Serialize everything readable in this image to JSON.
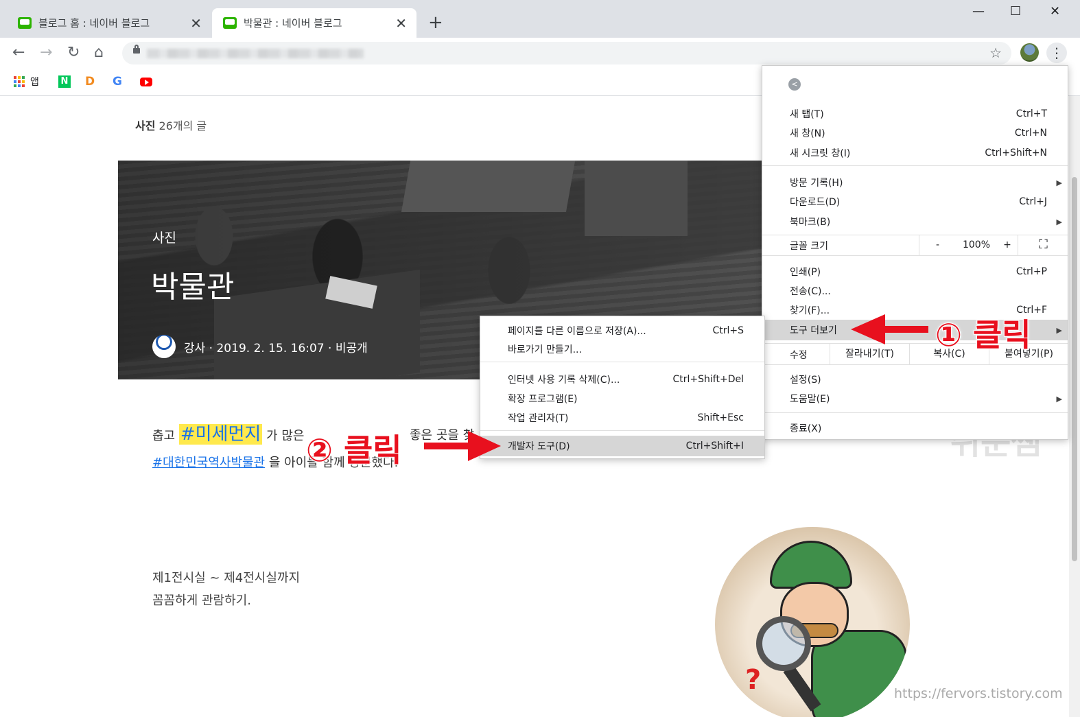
{
  "tabs": [
    {
      "title": "블로그 홈 : 네이버 블로그",
      "close": "✕"
    },
    {
      "title": "박물관 : 네이버 블로그",
      "close": "✕"
    }
  ],
  "new_tab": "+",
  "window_controls": {
    "minimize": "—",
    "maximize": "☐",
    "close": "✕"
  },
  "toolbar": {
    "back": "←",
    "forward": "→",
    "reload": "↻",
    "home": "⌂",
    "bookmark_star": "☆",
    "menu": "⋮"
  },
  "bookmarks": {
    "apps_label": "앱",
    "naver": "N",
    "daum": "D",
    "google": "G"
  },
  "page": {
    "category_name": "사진",
    "category_count": "26개의 글",
    "hero_category": "사진",
    "hero_title": "박물관",
    "hero_meta": "강사 · 2019. 2. 15. 16:07 · 비공개",
    "para1_a": "춥고 ",
    "para1_tag": "#미세먼지",
    "para1_b": " 가 많은",
    "para1_c": "좋은 곳을 찾",
    "para2_link": "#대한민국역사박물관",
    "para2_b": " 을 아이들",
    "para2_c": " 함께 방문했다.",
    "text_line1": "제1전시실 ~ 제4전시실까지",
    "text_line2": "꼼꼼하게 관람하기.",
    "watermark": "쉬운쌤",
    "credit": "https://fervors.tistory.com"
  },
  "menu": {
    "new_tab": "새 탭(T)",
    "new_tab_sc": "Ctrl+T",
    "new_window": "새 창(N)",
    "new_window_sc": "Ctrl+N",
    "incognito": "새 시크릿 창(I)",
    "incognito_sc": "Ctrl+Shift+N",
    "history": "방문 기록(H)",
    "downloads": "다운로드(D)",
    "downloads_sc": "Ctrl+J",
    "bookmarks": "북마크(B)",
    "font_size": "글꼴 크기",
    "zoom_minus": "-",
    "zoom_value": "100%",
    "zoom_plus": "+",
    "fullscreen": "⛶",
    "print": "인쇄(P)",
    "print_sc": "Ctrl+P",
    "cast": "전송(C)...",
    "find": "찾기(F)...",
    "find_sc": "Ctrl+F",
    "more_tools": "도구 더보기",
    "edit": "수정",
    "cut": "잘라내기(T)",
    "copy": "복사(C)",
    "paste": "붙여넣기(P)",
    "settings": "설정(S)",
    "help": "도움말(E)",
    "exit": "종료(X)",
    "arrow": "▶"
  },
  "submenu": {
    "save_as": "페이지를 다른 이름으로 저장(A)...",
    "save_as_sc": "Ctrl+S",
    "shortcut": "바로가기 만들기...",
    "clear_data": "인터넷 사용 기록 삭제(C)...",
    "clear_data_sc": "Ctrl+Shift+Del",
    "extensions": "확장 프로그램(E)",
    "task_manager": "작업 관리자(T)",
    "task_manager_sc": "Shift+Esc",
    "dev_tools": "개발자 도구(D)",
    "dev_tools_sc": "Ctrl+Shift+I"
  },
  "annotations": {
    "step1": "① 클릭",
    "step2": "② 클릭"
  },
  "colors": {
    "annotation": "#e8101e",
    "highlight": "#ffe94d",
    "link": "#1a73e8",
    "naver_green": "#03c75a"
  }
}
